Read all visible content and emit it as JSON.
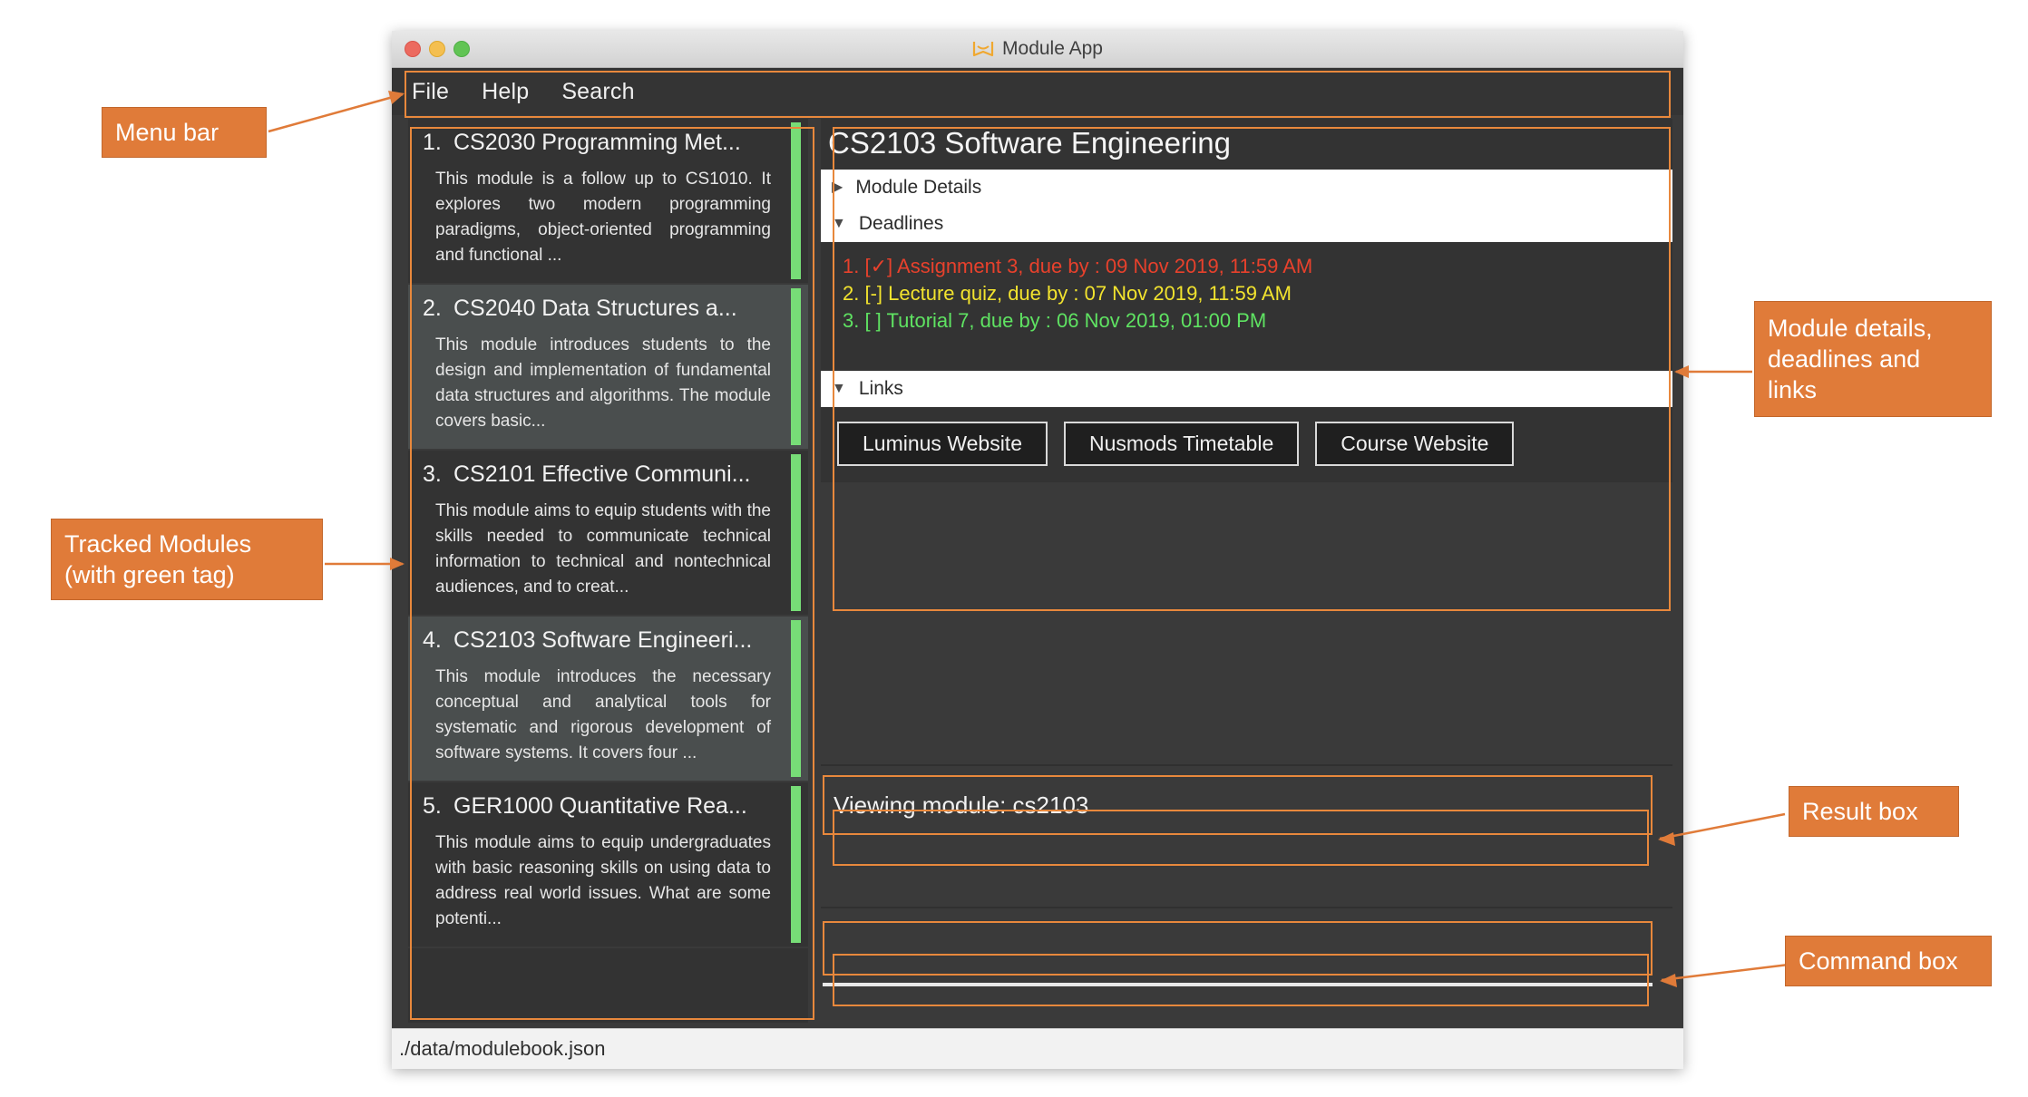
{
  "window": {
    "title": "Module App",
    "icon": "book-icon",
    "traffic_lights": [
      "close-red",
      "minimize-yellow",
      "maximize-green"
    ]
  },
  "menu_bar": {
    "items": [
      {
        "label": "File"
      },
      {
        "label": "Help"
      },
      {
        "label": "Search"
      }
    ]
  },
  "module_list": [
    {
      "index": "1.",
      "title": "CS2030 Programming Met...",
      "description": "This module is a follow up to CS1010. It explores two modern programming paradigms, object-oriented programming and functional ...",
      "tracked": true,
      "tag_color": "#77dd77"
    },
    {
      "index": "2.",
      "title": "CS2040 Data Structures a...",
      "description": "This module introduces students to the design and implementation of fundamental data structures and algorithms. The module covers basic...",
      "tracked": true,
      "tag_color": "#77dd77"
    },
    {
      "index": "3.",
      "title": "CS2101 Effective Communi...",
      "description": "This module aims to equip students with the skills needed to communicate technical information to technical and nontechnical audiences, and to creat...",
      "tracked": true,
      "tag_color": "#77dd77"
    },
    {
      "index": "4.",
      "title": "CS2103 Software Engineeri...",
      "description": "This module introduces the necessary conceptual and analytical tools for systematic and rigorous development of software systems. It covers four ...",
      "tracked": true,
      "tag_color": "#77dd77"
    },
    {
      "index": "5.",
      "title": "GER1000 Quantitative Rea...",
      "description": "This module aims to equip undergraduates with basic reasoning skills on using data to address real world issues. What are some potenti...",
      "tracked": true,
      "tag_color": "#77dd77"
    }
  ],
  "details": {
    "title": "CS2103 Software Engineering",
    "sections": [
      {
        "label": "Module Details",
        "expanded": false,
        "marker": "collapsed-triangle"
      },
      {
        "label": "Deadlines",
        "expanded": true,
        "marker": "expanded-triangle"
      },
      {
        "label": "Links",
        "expanded": true,
        "marker": "expanded-triangle"
      }
    ],
    "deadlines": [
      {
        "text": "1. [✓] Assignment 3, due by : 09 Nov 2019, 11:59 AM",
        "color": "#e8412c"
      },
      {
        "text": "2. [-] Lecture quiz, due by : 07 Nov 2019, 11:59 AM",
        "color": "#f2e32e"
      },
      {
        "text": "3. [ ] Tutorial 7, due by : 06 Nov 2019, 01:00 PM",
        "color": "#5fe362"
      }
    ],
    "links": [
      {
        "label": "Luminus Website"
      },
      {
        "label": "Nusmods Timetable"
      },
      {
        "label": "Course Website"
      }
    ]
  },
  "result_box": {
    "text": "Viewing module: cs2103"
  },
  "command_box": {
    "text": "",
    "placeholder": ""
  },
  "status_bar": {
    "text": "./data/modulebook.json"
  },
  "annotations": {
    "accent_color": "#e8883c",
    "callout_fill": "#e07b39",
    "items": [
      {
        "id": "menu-bar",
        "label": "Menu bar"
      },
      {
        "id": "tracked-modules",
        "label": "Tracked Modules\n(with green tag)"
      },
      {
        "id": "module-details",
        "label": "Module details,\ndeadlines and\nlinks"
      },
      {
        "id": "result-box",
        "label": "Result box"
      },
      {
        "id": "command-box",
        "label": "Command box"
      }
    ]
  }
}
